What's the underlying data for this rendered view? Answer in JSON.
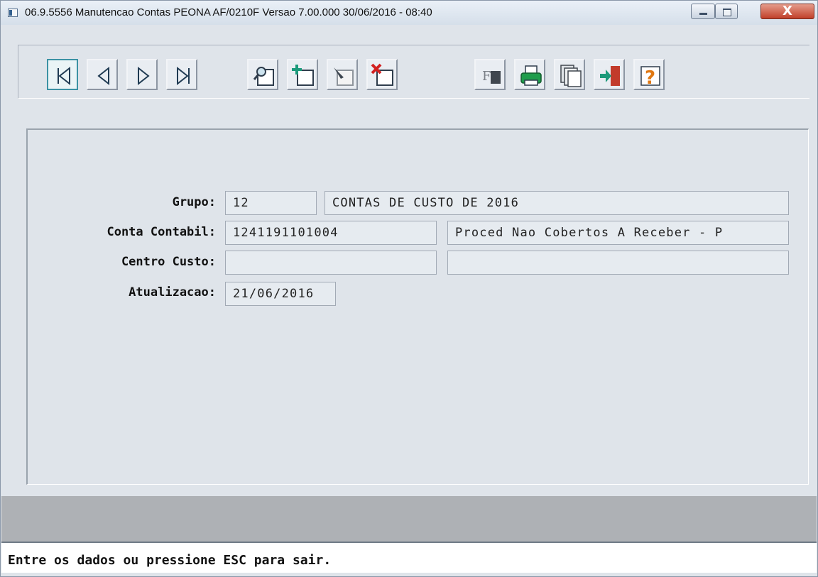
{
  "window": {
    "title": "06.9.5556 Manutencao Contas PEONA AF/0210F Versao 7.00.000 30/06/2016 - 08:40",
    "close_label": "X"
  },
  "toolbar": {
    "groups": [
      [
        "first-record-icon",
        "previous-record-icon",
        "next-record-icon",
        "last-record-icon"
      ],
      [
        "search-icon",
        "add-record-icon",
        "edit-record-icon",
        "delete-record-icon"
      ],
      [
        "filter-icon",
        "print-icon",
        "copy-icon",
        "exit-icon",
        "help-icon"
      ]
    ]
  },
  "form": {
    "grupo": {
      "label": "Grupo:",
      "code": "12",
      "description": "CONTAS DE CUSTO DE 2016"
    },
    "conta_contabil": {
      "label": "Conta Contabil:",
      "code": "1241191101004",
      "description": "Proced Nao Cobertos A Receber - P"
    },
    "centro_custo": {
      "label": "Centro Custo:",
      "code": "",
      "description": ""
    },
    "atualizacao": {
      "label": "Atualizacao:",
      "value": "21/06/2016"
    }
  },
  "status": {
    "message": "Entre os dados ou pressione ESC para sair."
  },
  "colors": {
    "window_bg": "#dfe4ea",
    "status_strip": "#aeb1b5",
    "close_button": "#c1402a",
    "field_bg": "#e6ebf0",
    "focus_border": "#3c92a4"
  }
}
